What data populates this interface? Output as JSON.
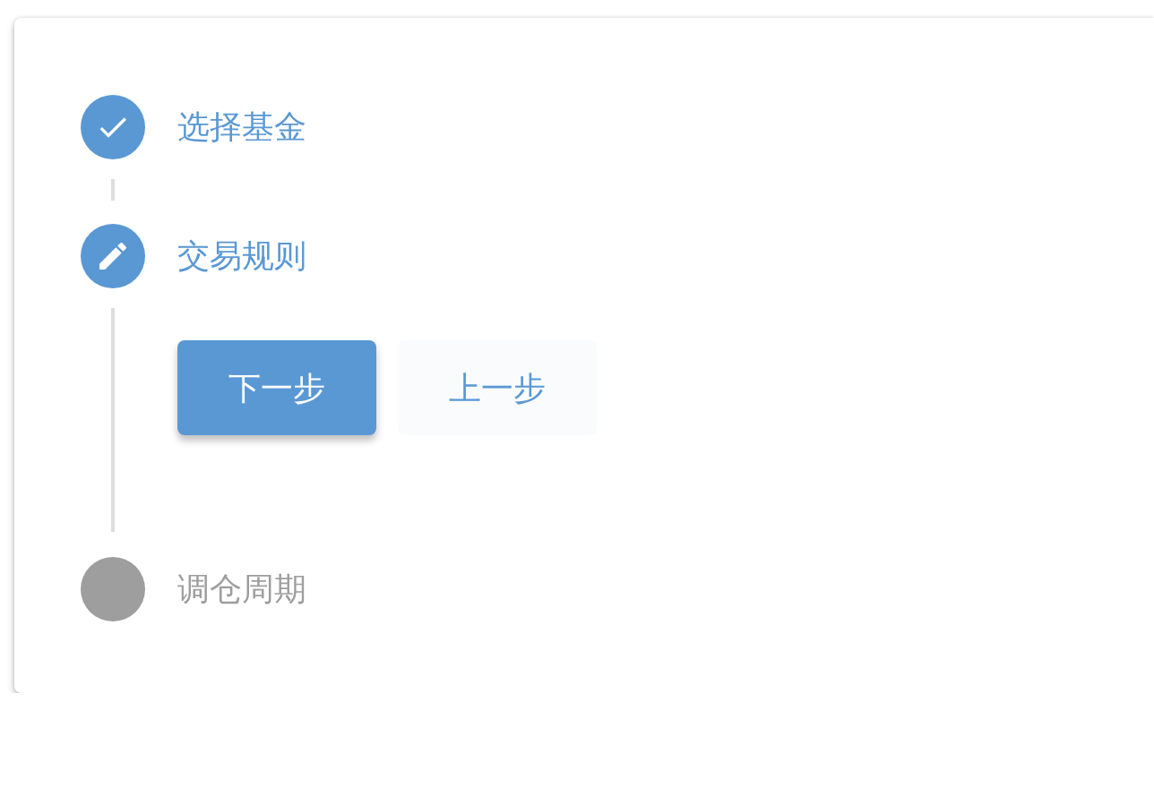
{
  "steps": [
    {
      "title": "选择基金",
      "kind": "complete"
    },
    {
      "title": "交易规则",
      "kind": "editing",
      "actions": [
        {
          "label": "下一步",
          "kind": "primary"
        },
        {
          "label": "上一步",
          "kind": "secondary"
        }
      ]
    },
    {
      "title": "调仓周期",
      "kind": "pending"
    }
  ]
}
